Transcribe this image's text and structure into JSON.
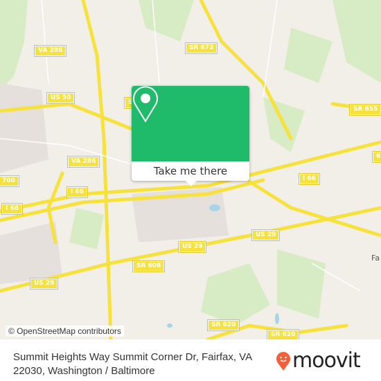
{
  "map": {
    "labels": [
      "VA 286",
      "US 50",
      "SR 672",
      "SR 655",
      "I 66",
      "VA 286",
      "700",
      "I 66",
      "I 66",
      "US 29",
      "US 29",
      "SR 608",
      "US 29",
      "SR 620",
      "SR 620",
      "66",
      "S"
    ],
    "places": [
      "Fa"
    ],
    "attribution": "© OpenStreetMap contributors",
    "colors": {
      "land": "#f2efe9",
      "road": "#f7e13c",
      "park": "#d7ecc4",
      "water": "#a9d3e8"
    }
  },
  "popup": {
    "icon": "map-pin-icon",
    "button_label": "Take me there",
    "color": "#1fba6a"
  },
  "footer": {
    "address": "Summit Heights Way Summit Corner Dr, Fairfax, VA 22030, Washington / Baltimore",
    "logo_text": "moovit",
    "logo_color": "#f2603b"
  }
}
